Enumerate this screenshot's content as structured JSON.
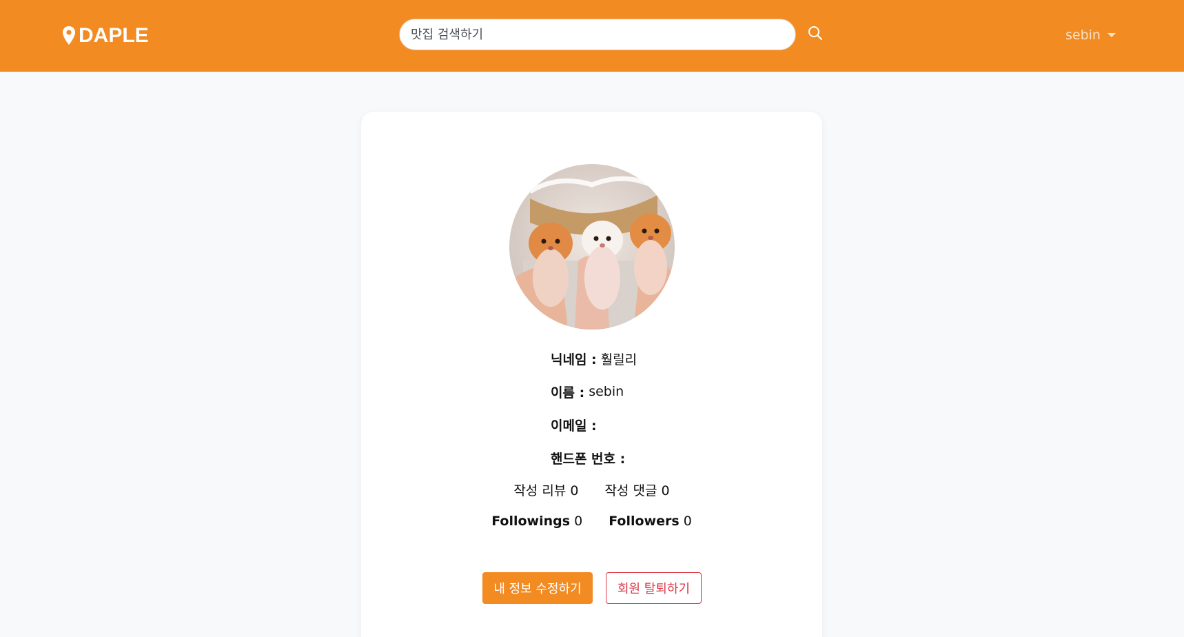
{
  "navbar": {
    "brand": "DAPLE",
    "search_placeholder": "맛집 검색하기",
    "username": "sebin"
  },
  "profile": {
    "nickname_label": "닉네임 :",
    "nickname": "훨릴리",
    "name_label": "이름 :",
    "name": "sebin",
    "email_label": "이메일 :",
    "email": "",
    "phone_label": "핸드폰 번호 :",
    "phone": "",
    "reviews_text": "작성 리뷰 0",
    "comments_text": "작성 댓글 0",
    "followings_label": "Followings",
    "followings_count": "0",
    "followers_label": "Followers",
    "followers_count": "0",
    "edit_button": "내 정보 수정하기",
    "withdraw_button": "회원 탈퇴하기"
  },
  "colors": {
    "primary": "#f28b22",
    "danger": "#dc3545",
    "background": "#f8f9fa"
  }
}
